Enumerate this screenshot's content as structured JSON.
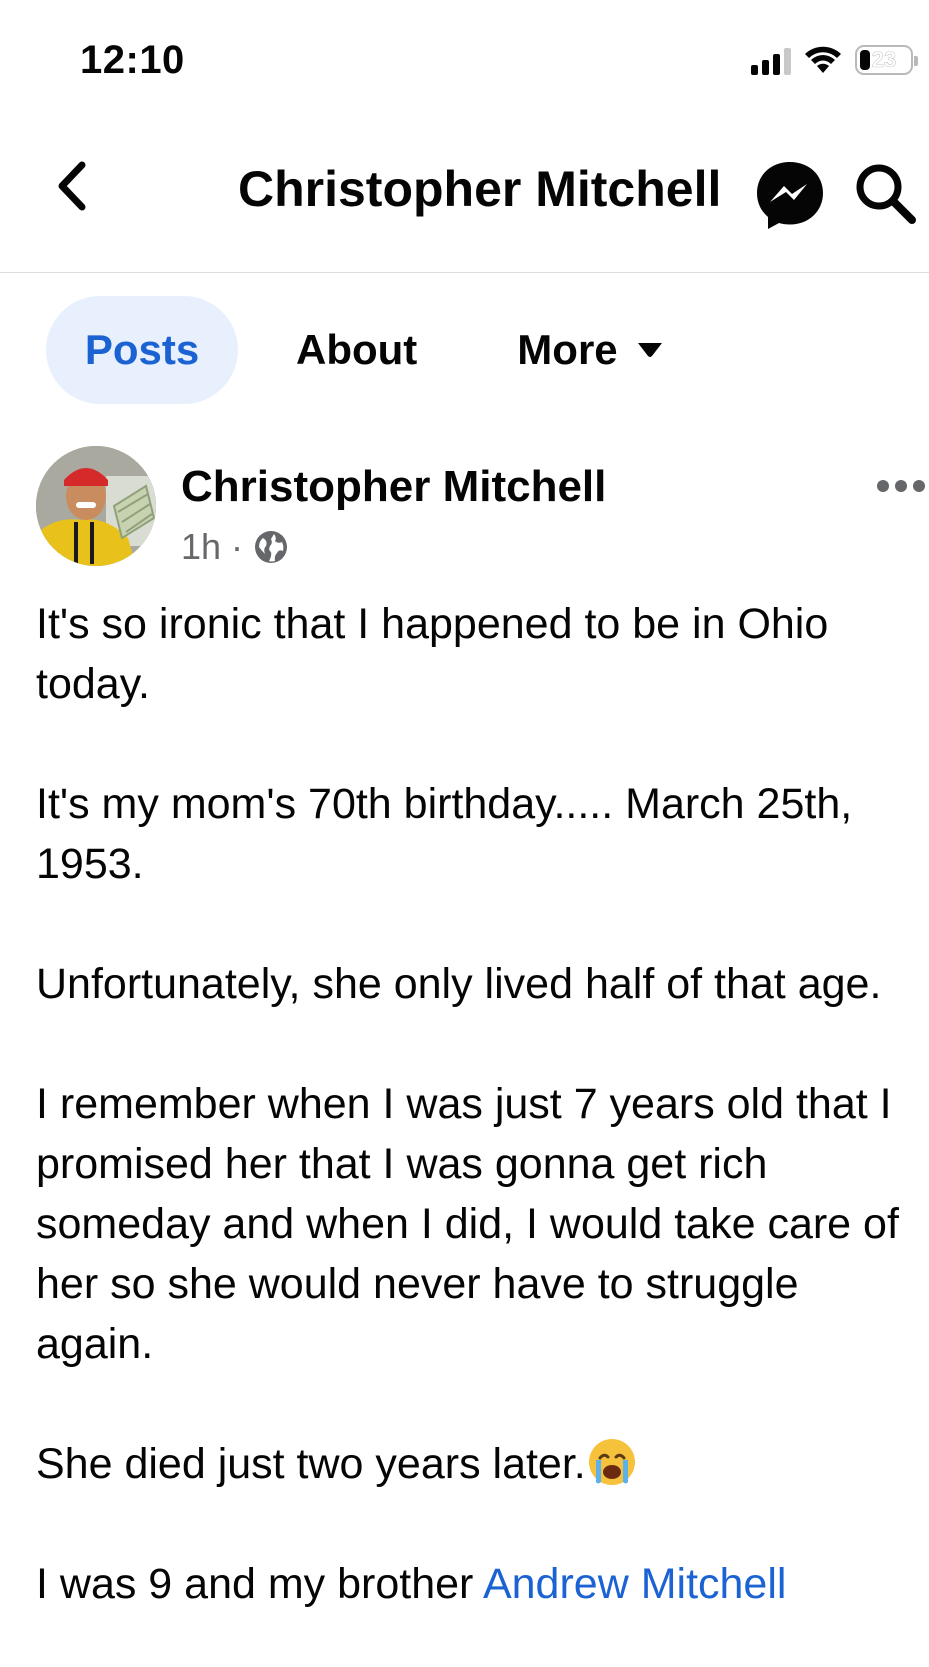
{
  "status_bar": {
    "time": "12:10",
    "battery_level": "23",
    "icons": [
      "signal-icon",
      "wifi-icon",
      "battery-icon"
    ]
  },
  "header": {
    "title": "Christopher Mitchell",
    "icons": [
      "back-chevron-icon",
      "messenger-icon",
      "search-icon"
    ]
  },
  "tabs": [
    {
      "label": "Posts",
      "active": true
    },
    {
      "label": "About",
      "active": false
    },
    {
      "label": "More",
      "active": false
    }
  ],
  "post": {
    "author": "Christopher Mitchell",
    "time": "1h",
    "separator": "·",
    "privacy_icon": "globe-icon",
    "paragraphs": [
      "It's so ironic that I happened to be in Ohio today.",
      "It's my mom's 70th birthday..... March 25th, 1953.",
      "Unfortunately, she only lived half of that age.",
      "I remember when I was just 7 years old that I promised her that I was gonna get rich someday and when I did, I would take care of her so she would never have to struggle again.",
      "She died just two years later."
    ],
    "last_line_prefix": "I was 9 and my brother ",
    "last_line_link": "Andrew Mitchell",
    "emoji": "crying-face-emoji"
  },
  "colors": {
    "accent": "#1b62d3",
    "active_tab_bg": "#e7f0fc",
    "text": "#050505",
    "secondary_text": "#65676b"
  }
}
